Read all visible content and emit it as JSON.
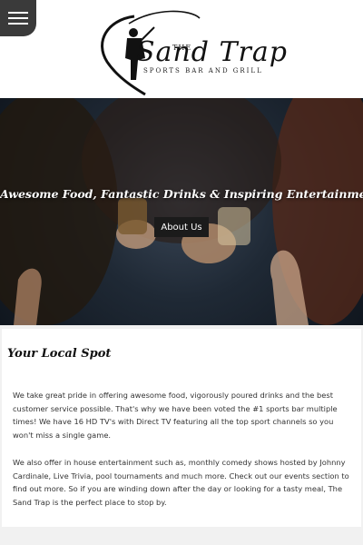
{
  "header": {
    "menu_icon": "hamburger-menu-icon",
    "logo": {
      "title": "Sand Trap",
      "the": "THE",
      "subtitle": "SPORTS BAR AND GRILL",
      "icon": "golfer-silhouette-icon"
    }
  },
  "hero": {
    "tagline": "Awesome Food, Fantastic Drinks & Inspiring Entertainment",
    "button_label": "About Us",
    "image_icon": "people-toasting-drinks-photo"
  },
  "section": {
    "heading": "Your Local Spot",
    "paragraphs": [
      "We take great pride in offering awesome food, vigorously poured drinks and the best customer service possible. That's why we have been voted the #1 sports bar multiple times! We have 16 HD TV's with Direct TV featuring all the top sport channels so you won't miss a single game.",
      "We also offer in house entertainment such as, monthly comedy shows hosted by Johnny Cardinale, Live Trivia, pool tournaments and much more. Check out our events section to find out more. So if you are winding down after the day or looking for a tasty meal, The Sand Trap is the perfect place to stop by."
    ]
  },
  "colors": {
    "menu_bg": "#3a3a3a",
    "page_bg": "#f1f1f1",
    "button_bg": "#1b1b1b"
  }
}
